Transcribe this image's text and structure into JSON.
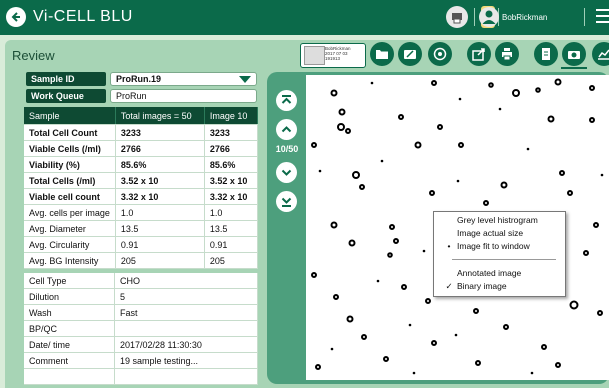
{
  "app": {
    "title": "Vi-CELL BLU",
    "user_name": "BobRickman"
  },
  "review": {
    "title": "Review"
  },
  "thumbnail": {
    "line1": "BobRickman",
    "line2": "2017 07 03",
    "line3": "191913"
  },
  "sample": {
    "sample_id_label": "Sample ID",
    "sample_id_value": "ProRun.19",
    "work_queue_label": "Work Queue",
    "work_queue_value": "ProRun"
  },
  "results": {
    "headers": [
      "Sample",
      "Total images = 50",
      "Image 10"
    ],
    "rows": [
      [
        "Total Cell Count",
        "3233",
        "3233"
      ],
      [
        "Viable Cells (/ml)",
        "2766",
        "2766"
      ],
      [
        "Viability (%)",
        "85.6%",
        "85.6%"
      ],
      [
        "Total Cells (/ml)",
        "3.52 x 10",
        "3.52 x 10"
      ],
      [
        "Viable cell count",
        "3.32 x 10",
        "3.32 x 10"
      ],
      [
        "Avg. cells per image",
        "1.0",
        "1.0"
      ],
      [
        "Avg. Diameter",
        "13.5",
        "13.5"
      ],
      [
        "Avg. Circularity",
        "0.91",
        "0.91"
      ],
      [
        "Avg. BG Intensity",
        "205",
        "205"
      ]
    ]
  },
  "meta": {
    "rows": [
      [
        "Cell Type",
        "CHO"
      ],
      [
        "Dilution",
        "5"
      ],
      [
        "Wash",
        "Fast"
      ],
      [
        "BP/QC",
        ""
      ],
      [
        "Date/ time",
        "2017/02/28 11:30:30"
      ],
      [
        "Comment",
        "19 sample testing..."
      ],
      [
        "",
        ""
      ]
    ]
  },
  "viewer": {
    "counter": "10/50"
  },
  "context_menu": {
    "items": [
      {
        "label": "Grey level histrogram",
        "mark": ""
      },
      {
        "label": "Image actual size",
        "mark": ""
      },
      {
        "label": "Image fit to window",
        "mark": "•"
      },
      {
        "label": "Annotated image",
        "mark": ""
      },
      {
        "label": "Binary image",
        "mark": "✓"
      }
    ]
  },
  "colors": {
    "brand": "#0b6a4a",
    "panel": "#a7d4b5",
    "header_dark": "#0e4a33"
  }
}
